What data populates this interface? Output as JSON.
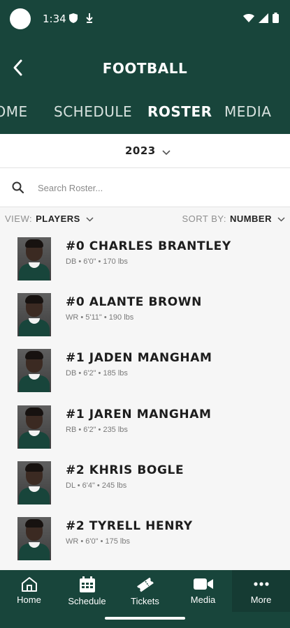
{
  "status_bar": {
    "time": "1:34"
  },
  "header": {
    "title": "FOOTBALL"
  },
  "tabs": [
    {
      "label": "HOME"
    },
    {
      "label": "SCHEDULE"
    },
    {
      "label": "ROSTER"
    },
    {
      "label": "MEDIA"
    }
  ],
  "season": {
    "year": "2023"
  },
  "search": {
    "placeholder": "Search Roster..."
  },
  "filters": {
    "view_label": "VIEW:",
    "view_value": "PLAYERS",
    "sort_label": "SORT BY:",
    "sort_value": "NUMBER"
  },
  "players": [
    {
      "name": "#0 CHARLES BRANTLEY",
      "meta": "DB • 6'0\" • 170 lbs"
    },
    {
      "name": "#0 ALANTE BROWN",
      "meta": "WR • 5'11\" • 190 lbs"
    },
    {
      "name": "#1 JADEN MANGHAM",
      "meta": "DB • 6'2\" • 185 lbs"
    },
    {
      "name": "#1 JAREN MANGHAM",
      "meta": "RB • 6'2\" • 235 lbs"
    },
    {
      "name": "#2 KHRIS BOGLE",
      "meta": "DL • 6'4\" • 245 lbs"
    },
    {
      "name": "#2 TYRELL HENRY",
      "meta": "WR • 6'0\" • 175 lbs"
    }
  ],
  "bottom_nav": [
    {
      "label": "Home",
      "icon": "home-icon"
    },
    {
      "label": "Schedule",
      "icon": "calendar-icon"
    },
    {
      "label": "Tickets",
      "icon": "ticket-icon"
    },
    {
      "label": "Media",
      "icon": "video-camera-icon"
    },
    {
      "label": "More",
      "icon": "more-dots-icon"
    }
  ],
  "colors": {
    "brand_green": "#18453b",
    "background": "#f6f6f6"
  }
}
